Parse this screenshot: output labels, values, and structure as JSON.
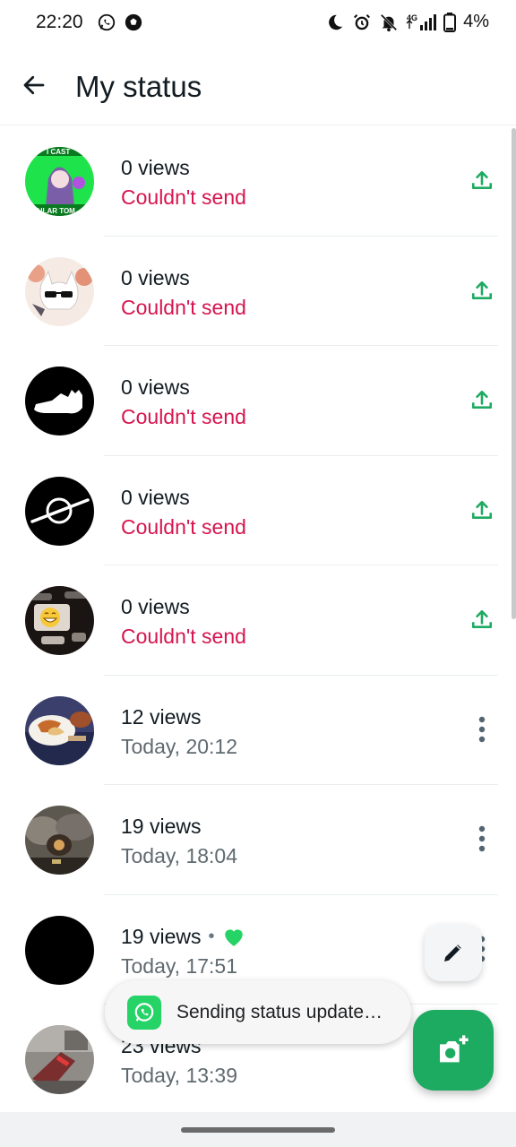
{
  "status_bar": {
    "time": "22:20",
    "left_icons": [
      "whatsapp-icon",
      "soccer-ball-icon"
    ],
    "right_icons": [
      "moon-icon",
      "alarm-icon",
      "bell-off-icon",
      "signal-4g-icon",
      "battery-icon"
    ],
    "network": "4G",
    "battery": "4%"
  },
  "app_bar": {
    "title": "My status",
    "back_icon": "arrow-back-icon"
  },
  "statuses": [
    {
      "views": "0 views",
      "subtitle": "Couldn't send",
      "state": "error",
      "action_icon": "upload-icon",
      "thumb": "anime-green"
    },
    {
      "views": "0 views",
      "subtitle": "Couldn't send",
      "state": "error",
      "action_icon": "upload-icon",
      "thumb": "cartoon-sunglasses"
    },
    {
      "views": "0 views",
      "subtitle": "Couldn't send",
      "state": "error",
      "action_icon": "upload-icon",
      "thumb": "black-cat"
    },
    {
      "views": "0 views",
      "subtitle": "Couldn't send",
      "state": "error",
      "action_icon": "upload-icon",
      "thumb": "black-planet"
    },
    {
      "views": "0 views",
      "subtitle": "Couldn't send",
      "state": "error",
      "action_icon": "upload-icon",
      "thumb": "emoji-screenshot"
    },
    {
      "views": "12 views",
      "subtitle": "Today, 20:12",
      "state": "sent",
      "action_icon": "more-vert-icon",
      "thumb": "food-plate"
    },
    {
      "views": "19 views",
      "subtitle": "Today, 18:04",
      "state": "sent",
      "action_icon": "more-vert-icon",
      "thumb": "smoke-scene"
    },
    {
      "views": "19 views",
      "subtitle": "Today, 17:51",
      "state": "sent",
      "action_icon": "more-vert-icon",
      "thumb": "black",
      "reaction": "heart-icon"
    },
    {
      "views": "23 views",
      "subtitle": "Today, 13:39",
      "state": "sent",
      "action_icon": "more-vert-icon",
      "thumb": "game-screenshot"
    }
  ],
  "separator": "•",
  "toast": {
    "text": "Sending status update…",
    "icon": "whatsapp-icon"
  },
  "fabs": {
    "pencil_icon": "pencil-icon",
    "camera_icon": "camera-add-icon"
  },
  "colors": {
    "error": "#d6144e",
    "accent": "#1daa61",
    "upload_icon": "#1daa61",
    "heart": "#25d366"
  }
}
